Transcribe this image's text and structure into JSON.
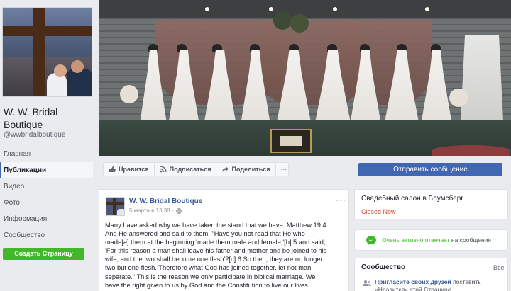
{
  "page": {
    "name": "W. W. Bridal Boutique",
    "handle": "@wwbridalboutique"
  },
  "nav": {
    "items": [
      "Главная",
      "Публикации",
      "Видео",
      "Фото",
      "Информация",
      "Сообщество"
    ],
    "active_index": 1,
    "create_page": "Создать Страницу"
  },
  "actions": {
    "like": "Нравится",
    "follow": "Подписаться",
    "share": "Поделиться",
    "more": "···",
    "send_message": "Отправить сообщение"
  },
  "post": {
    "author": "W. W. Bridal Boutique",
    "date": "5 марта в 13:38",
    "more": "···",
    "text": "Many have asked why we have taken the stand that we have. Matthew 19:4\nAnd He answered and said to them, \"Have you not read that He who\nmade[a] them at the beginning 'made them male and female,'[b] 5 and said,\n'For this reason a man shall leave his father and mother and be joined to his\nwife, and the two shall become one flesh'?[c] 6 So then, they are no longer\ntwo but one flesh. Therefore what God has joined together, let not man\nseparate.\" This is the reason we only participate in biblical marriage. We\nhave the right given to us by God and the Constitution to live our lives"
  },
  "info": {
    "category": "Свадебный салон в Блумсберг",
    "status": "Closed Now",
    "status_color": "#d64a33"
  },
  "response": {
    "highlight": "Очень активно отвечает",
    "rest": " на сообщения"
  },
  "community": {
    "title": "Сообщество",
    "see_all": "Все",
    "invite_link": "Пригласите своих друзей",
    "invite_rest": " поставить «Нравится» этой Странице"
  },
  "colors": {
    "facebook_blue": "#4267b2",
    "link_blue": "#385898",
    "create_green": "#42b72a",
    "background": "#e9ebee"
  }
}
